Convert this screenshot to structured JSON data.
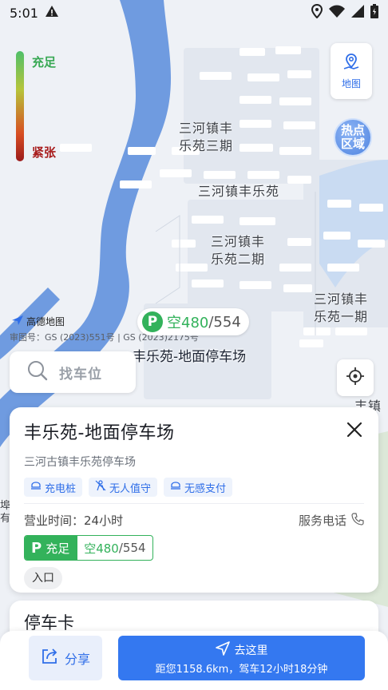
{
  "status_bar": {
    "time": "5:01"
  },
  "legend": {
    "top_label": "充足",
    "bottom_label": "紧张"
  },
  "map_button": {
    "label": "地图"
  },
  "hot_area": {
    "label": "热点\n区域"
  },
  "map_labels": [
    {
      "id": "sanqi",
      "text": "三河镇丰\n乐苑三期"
    },
    {
      "id": "main",
      "text": "三河镇丰乐苑"
    },
    {
      "id": "erqi",
      "text": "三河镇丰\n乐苑二期"
    },
    {
      "id": "yiqi",
      "text": "三河镇丰\n乐苑一期"
    },
    {
      "id": "edge-right",
      "text": "丰镇家"
    },
    {
      "id": "edge-left",
      "text": "埠\n有"
    }
  ],
  "amap": {
    "logo_text": "高德地图",
    "approval": "审图号：GS (2023)551号 | GS (2023)2175号"
  },
  "marker": {
    "p": "P",
    "free_label": "空480",
    "total": "/554",
    "name": "丰乐苑-地面停车场"
  },
  "search": {
    "placeholder": "找车位"
  },
  "card": {
    "title": "丰乐苑-地面停车场",
    "subtitle": "三河古镇丰乐苑停车场",
    "tags": [
      "充电桩",
      "无人值守",
      "无感支付"
    ],
    "hours": "营业时间：24小时",
    "phone_label": "服务电话",
    "status": {
      "p": "P",
      "level": "充足",
      "free_label": "空480",
      "total": "/554"
    },
    "entrance": "入口"
  },
  "card2": {
    "title": "停车卡"
  },
  "bottom": {
    "share": "分享",
    "go_title": "去这里",
    "go_detail": "距您1158.6km，驾车12小时18分钟"
  },
  "colors": {
    "accent": "#3478f0",
    "green": "#33b25b",
    "river": "#5f8fd9"
  }
}
